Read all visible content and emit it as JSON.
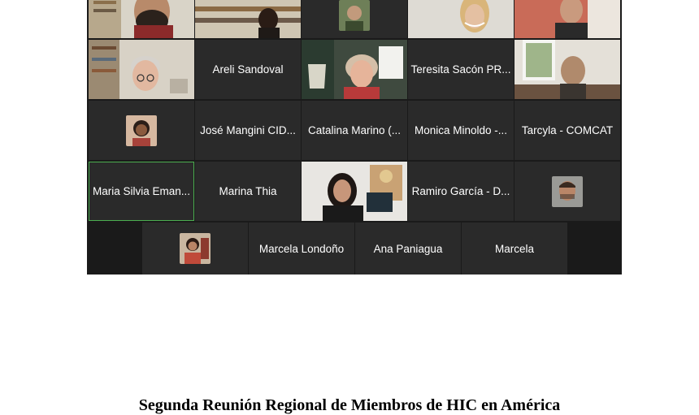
{
  "meeting": {
    "participants": {
      "areli": "Areli Sandoval",
      "teresita": "Teresita Sacón PR...",
      "jose": "José Mangini CID...",
      "catalina": "Catalina Marino (...",
      "monica": "Monica Minoldo -...",
      "tarcyla": "Tarcyla - COMCAT",
      "maria_silvia": "Maria Silvia Eman...",
      "marina": "Marina Thia",
      "ramiro": "Ramiro García - D...",
      "marcela_londono": "Marcela Londoño",
      "ana": "Ana Paniagua",
      "marcela": "Marcela"
    },
    "colors": {
      "tile": "#2a2a2a",
      "background": "#1a1a1a",
      "active_speaker": "#4caf50"
    }
  },
  "caption": "Segunda Reunión Regional de Miembros de HIC en América"
}
